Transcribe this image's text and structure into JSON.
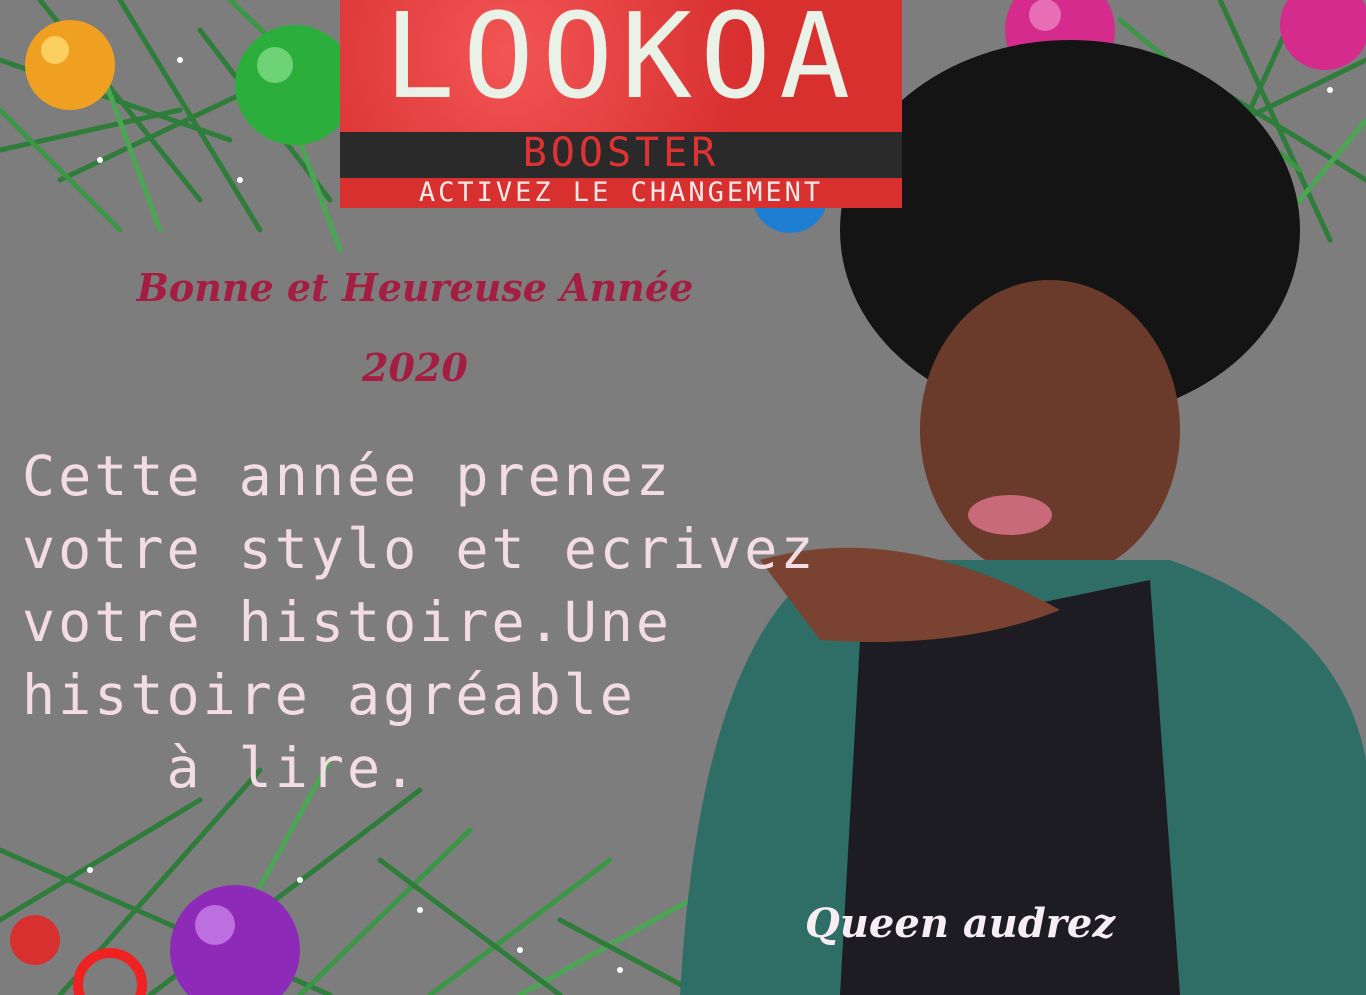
{
  "brand": {
    "name": "LOOKOA",
    "subtitle": "BOOSTER",
    "tagline": "ACTIVEZ LE CHANGEMENT"
  },
  "greeting": {
    "line1": "Bonne et Heureuse Année",
    "line2": "2020"
  },
  "message": {
    "line1": "Cette année prenez",
    "line2": "votre stylo et ecrivez",
    "line3": "votre histoire.Une",
    "line4": "histoire agréable",
    "line5": "    à lire."
  },
  "signature": "Queen audrez",
  "colors": {
    "background": "#7d7d7d",
    "logo_red": "#e23a3a",
    "greeting": "#a41e42",
    "message": "#f3dce4"
  }
}
